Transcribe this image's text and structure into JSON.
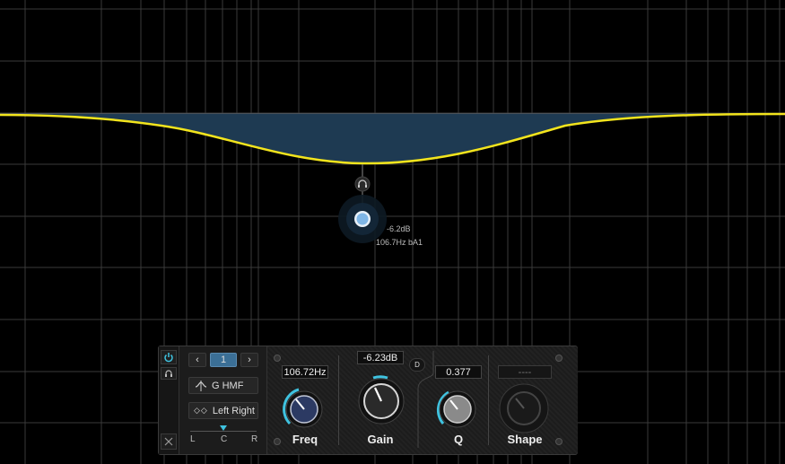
{
  "eq_display": {
    "node": {
      "gain_readout": "-6.2dB",
      "freq_readout": "106.7Hz bA1"
    }
  },
  "band_panel": {
    "band_number": "1",
    "band_type": "G HMF",
    "channel_mode": "Left Right",
    "pan_labels": [
      "L",
      "C",
      "R"
    ],
    "freq": {
      "label": "Freq",
      "value": "106.72Hz"
    },
    "gain": {
      "label": "Gain",
      "value": "-6.23dB"
    },
    "q": {
      "label": "Q",
      "value": "0.377"
    },
    "shape": {
      "label": "Shape",
      "value": "----"
    },
    "d_button": "D"
  },
  "colors": {
    "curve": "#f2e41d",
    "fill": "#1e3a52",
    "accent": "#3fc3e0",
    "node": "#7fb6e6"
  },
  "icons": {
    "prev": "chevron-left-icon",
    "next": "chevron-right-icon",
    "power": "power-icon",
    "listen": "headphones-icon",
    "close": "close-icon"
  }
}
